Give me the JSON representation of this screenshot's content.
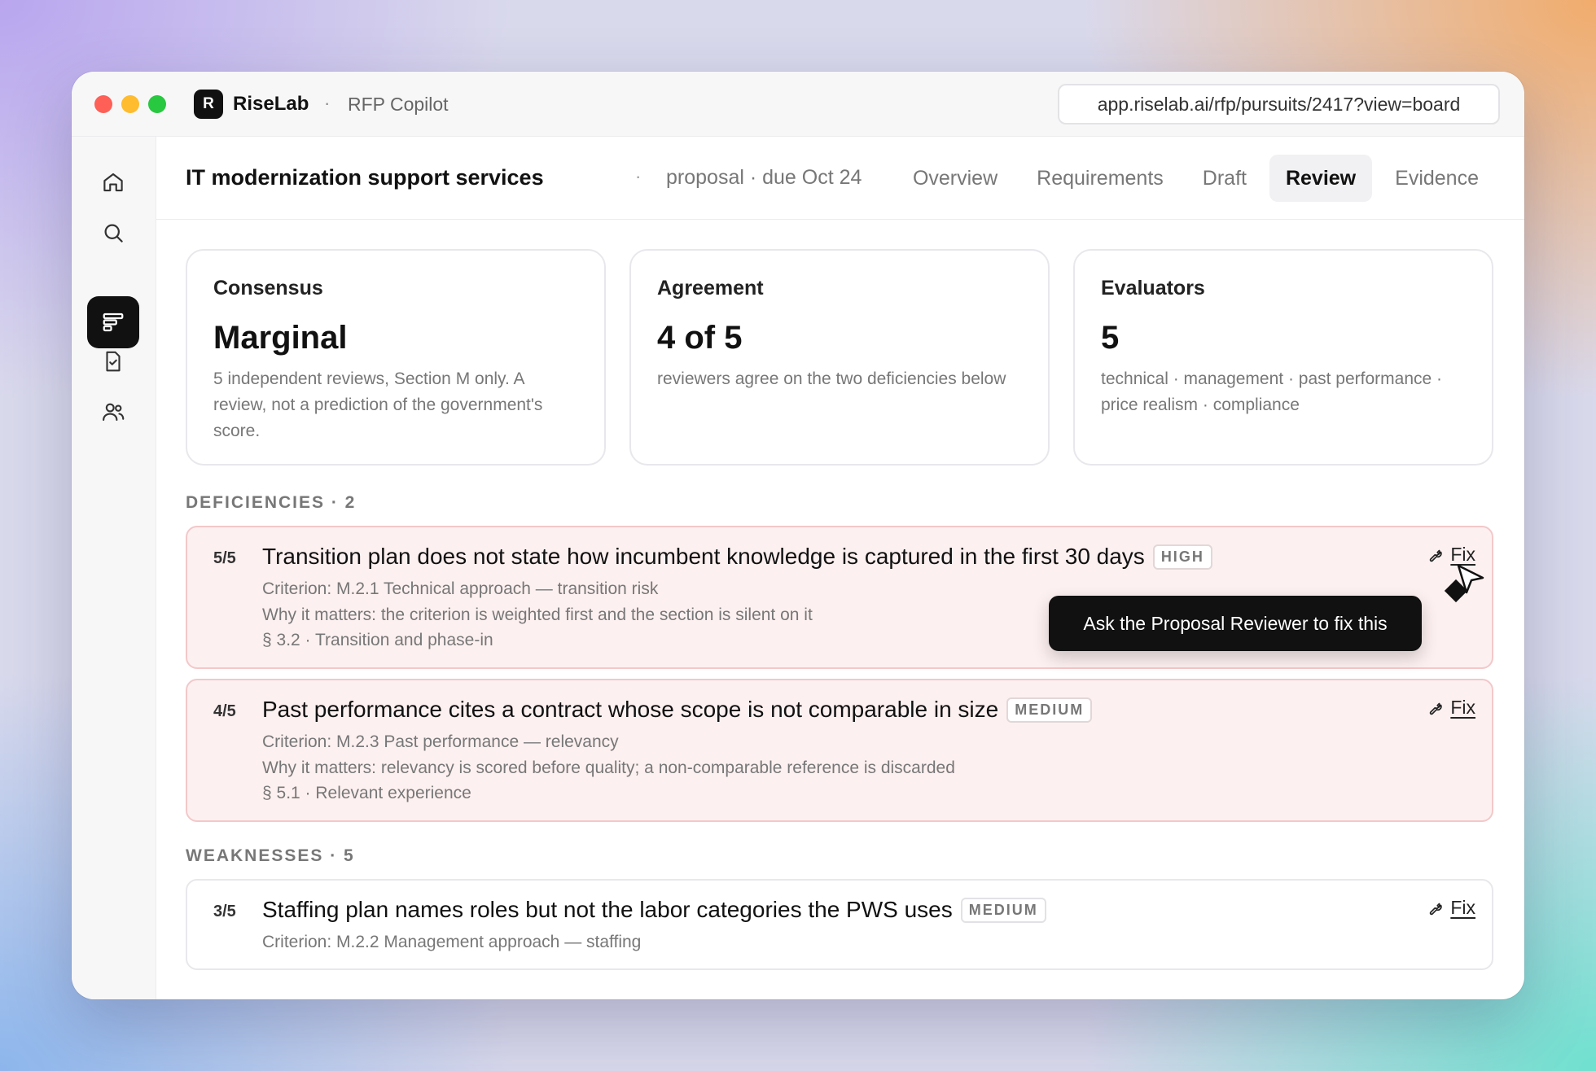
{
  "titlebar": {
    "brand_initial": "R",
    "brand_name": "RiseLab",
    "separator": "·",
    "app_name": "RFP Copilot",
    "url": "app.riselab.ai/rfp/pursuits/2417?view=board"
  },
  "sidebar": {
    "items": [
      {
        "icon": "home-icon",
        "active": false
      },
      {
        "icon": "search-icon",
        "active": false
      },
      {
        "icon": "board-icon",
        "active": true
      },
      {
        "icon": "document-check-icon",
        "active": false
      },
      {
        "icon": "users-icon",
        "active": false
      }
    ]
  },
  "header": {
    "title": "IT modernization support services",
    "separator": "·",
    "subtitle": "proposal · due Oct 24",
    "tabs": [
      {
        "label": "Overview",
        "active": false
      },
      {
        "label": "Requirements",
        "active": false
      },
      {
        "label": "Draft",
        "active": false
      },
      {
        "label": "Review",
        "active": true
      },
      {
        "label": "Evidence",
        "active": false
      }
    ]
  },
  "cards": [
    {
      "label": "Consensus",
      "value": "Marginal",
      "desc": "5 independent reviews, Section M only. A review, not a prediction of the government's score."
    },
    {
      "label": "Agreement",
      "value": "4 of 5",
      "desc": "reviewers agree on the two deficiencies below"
    },
    {
      "label": "Evaluators",
      "value": "5",
      "desc": "technical · management · past performance · price realism · compliance"
    }
  ],
  "deficiencies": {
    "title": "DEFICIENCIES · 2",
    "items": [
      {
        "score": "5/5",
        "title": "Transition plan does not state how incumbent knowledge is captured in the first 30 days",
        "severity": "HIGH",
        "criterion": "Criterion: M.2.1 Technical approach — transition risk",
        "why": "Why it matters: the criterion is weighted first and the section is silent on it",
        "section": "§ 3.2 · Transition and phase-in",
        "fix_label": "Fix"
      },
      {
        "score": "4/5",
        "title": "Past performance cites a contract whose scope is not comparable in size",
        "severity": "MEDIUM",
        "criterion": "Criterion: M.2.3 Past performance — relevancy",
        "why": "Why it matters: relevancy is scored before quality; a non-comparable reference is discarded",
        "section": "§ 5.1 · Relevant experience",
        "fix_label": "Fix"
      }
    ]
  },
  "weaknesses": {
    "title": "WEAKNESSES · 5",
    "items": [
      {
        "score": "3/5",
        "title": "Staffing plan names roles but not the labor categories the PWS uses",
        "severity": "MEDIUM",
        "criterion": "Criterion: M.2.2 Management approach — staffing",
        "fix_label": "Fix"
      }
    ]
  },
  "tooltip": {
    "text": "Ask the Proposal Reviewer to fix this"
  },
  "colors": {
    "accent": "#111111",
    "deficiency_bg": "#fdf0f0",
    "deficiency_border": "#f3c8c9"
  }
}
